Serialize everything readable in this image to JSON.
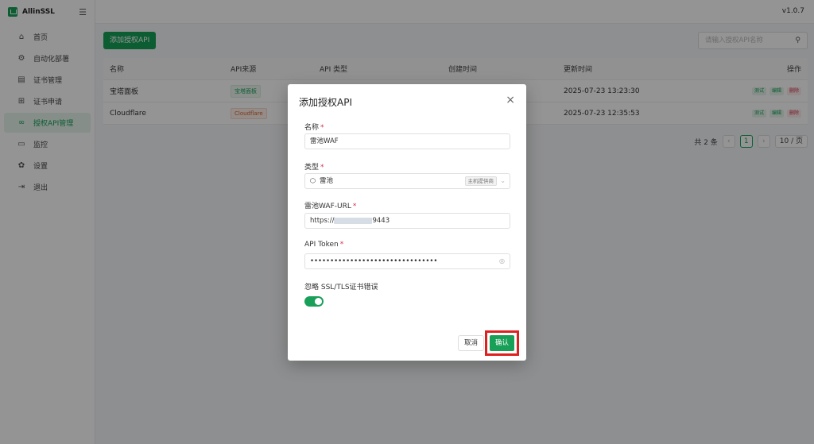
{
  "sidebar": {
    "brand": "AllinSSL",
    "items": [
      {
        "label": "首页",
        "icon": "home-icon"
      },
      {
        "label": "自动化部署",
        "icon": "workflow-icon"
      },
      {
        "label": "证书管理",
        "icon": "certificate-icon"
      },
      {
        "label": "证书申请",
        "icon": "add-certificate-icon"
      },
      {
        "label": "授权API管理",
        "icon": "link-icon",
        "active": true
      },
      {
        "label": "监控",
        "icon": "monitor-icon"
      },
      {
        "label": "设置",
        "icon": "gear-icon"
      },
      {
        "label": "退出",
        "icon": "logout-icon"
      }
    ]
  },
  "header": {
    "version": "v1.0.7"
  },
  "toolbar": {
    "add_label": "添加授权API",
    "search_placeholder": "请输入授权API名称"
  },
  "table": {
    "headers": [
      "名称",
      "API来源",
      "API 类型",
      "创建时间",
      "更新时间",
      "操作"
    ],
    "rows": [
      {
        "name": "宝塔面板",
        "source": "宝塔面板",
        "updated": "2025-07-23 13:23:30"
      },
      {
        "name": "Cloudflare",
        "source": "Cloudflare",
        "updated": "2025-07-23 12:35:53"
      }
    ],
    "actions": [
      "测试",
      "编辑",
      "删除"
    ]
  },
  "pagination": {
    "total": "共 2 条",
    "prev": "‹",
    "current": "1",
    "next": "›",
    "page_size": "10 / 页"
  },
  "modal": {
    "title": "添加授权API",
    "close": "×",
    "name_label": "名称",
    "name_value": "雷池WAF",
    "type_label": "类型",
    "type_value": "雷池",
    "type_badge": "主机提供商",
    "url_label": "雷池WAF-URL",
    "url_prefix": "https://",
    "url_suffix": "9443",
    "token_label": "API Token",
    "token_value": "••••••••••••••••••••••••••••••••",
    "ssl_label": "忽略 SSL/TLS证书错误",
    "ssl_enabled": true,
    "cancel_label": "取消",
    "confirm_label": "确认",
    "required_mark": "*"
  },
  "colors": {
    "primary": "#18a058",
    "highlight": "#e02020",
    "danger": "#d03050"
  }
}
